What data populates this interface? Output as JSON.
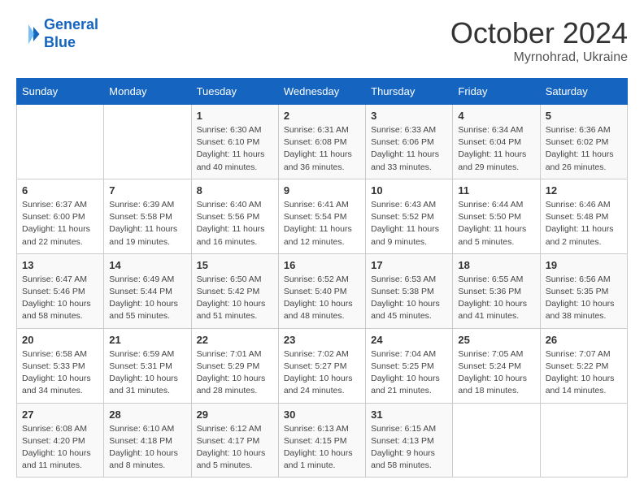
{
  "header": {
    "logo_line1": "General",
    "logo_line2": "Blue",
    "month": "October 2024",
    "location": "Myrnohrad, Ukraine"
  },
  "days_of_week": [
    "Sunday",
    "Monday",
    "Tuesday",
    "Wednesday",
    "Thursday",
    "Friday",
    "Saturday"
  ],
  "weeks": [
    [
      {
        "day": "",
        "detail": ""
      },
      {
        "day": "",
        "detail": ""
      },
      {
        "day": "1",
        "detail": "Sunrise: 6:30 AM\nSunset: 6:10 PM\nDaylight: 11 hours and 40 minutes."
      },
      {
        "day": "2",
        "detail": "Sunrise: 6:31 AM\nSunset: 6:08 PM\nDaylight: 11 hours and 36 minutes."
      },
      {
        "day": "3",
        "detail": "Sunrise: 6:33 AM\nSunset: 6:06 PM\nDaylight: 11 hours and 33 minutes."
      },
      {
        "day": "4",
        "detail": "Sunrise: 6:34 AM\nSunset: 6:04 PM\nDaylight: 11 hours and 29 minutes."
      },
      {
        "day": "5",
        "detail": "Sunrise: 6:36 AM\nSunset: 6:02 PM\nDaylight: 11 hours and 26 minutes."
      }
    ],
    [
      {
        "day": "6",
        "detail": "Sunrise: 6:37 AM\nSunset: 6:00 PM\nDaylight: 11 hours and 22 minutes."
      },
      {
        "day": "7",
        "detail": "Sunrise: 6:39 AM\nSunset: 5:58 PM\nDaylight: 11 hours and 19 minutes."
      },
      {
        "day": "8",
        "detail": "Sunrise: 6:40 AM\nSunset: 5:56 PM\nDaylight: 11 hours and 16 minutes."
      },
      {
        "day": "9",
        "detail": "Sunrise: 6:41 AM\nSunset: 5:54 PM\nDaylight: 11 hours and 12 minutes."
      },
      {
        "day": "10",
        "detail": "Sunrise: 6:43 AM\nSunset: 5:52 PM\nDaylight: 11 hours and 9 minutes."
      },
      {
        "day": "11",
        "detail": "Sunrise: 6:44 AM\nSunset: 5:50 PM\nDaylight: 11 hours and 5 minutes."
      },
      {
        "day": "12",
        "detail": "Sunrise: 6:46 AM\nSunset: 5:48 PM\nDaylight: 11 hours and 2 minutes."
      }
    ],
    [
      {
        "day": "13",
        "detail": "Sunrise: 6:47 AM\nSunset: 5:46 PM\nDaylight: 10 hours and 58 minutes."
      },
      {
        "day": "14",
        "detail": "Sunrise: 6:49 AM\nSunset: 5:44 PM\nDaylight: 10 hours and 55 minutes."
      },
      {
        "day": "15",
        "detail": "Sunrise: 6:50 AM\nSunset: 5:42 PM\nDaylight: 10 hours and 51 minutes."
      },
      {
        "day": "16",
        "detail": "Sunrise: 6:52 AM\nSunset: 5:40 PM\nDaylight: 10 hours and 48 minutes."
      },
      {
        "day": "17",
        "detail": "Sunrise: 6:53 AM\nSunset: 5:38 PM\nDaylight: 10 hours and 45 minutes."
      },
      {
        "day": "18",
        "detail": "Sunrise: 6:55 AM\nSunset: 5:36 PM\nDaylight: 10 hours and 41 minutes."
      },
      {
        "day": "19",
        "detail": "Sunrise: 6:56 AM\nSunset: 5:35 PM\nDaylight: 10 hours and 38 minutes."
      }
    ],
    [
      {
        "day": "20",
        "detail": "Sunrise: 6:58 AM\nSunset: 5:33 PM\nDaylight: 10 hours and 34 minutes."
      },
      {
        "day": "21",
        "detail": "Sunrise: 6:59 AM\nSunset: 5:31 PM\nDaylight: 10 hours and 31 minutes."
      },
      {
        "day": "22",
        "detail": "Sunrise: 7:01 AM\nSunset: 5:29 PM\nDaylight: 10 hours and 28 minutes."
      },
      {
        "day": "23",
        "detail": "Sunrise: 7:02 AM\nSunset: 5:27 PM\nDaylight: 10 hours and 24 minutes."
      },
      {
        "day": "24",
        "detail": "Sunrise: 7:04 AM\nSunset: 5:25 PM\nDaylight: 10 hours and 21 minutes."
      },
      {
        "day": "25",
        "detail": "Sunrise: 7:05 AM\nSunset: 5:24 PM\nDaylight: 10 hours and 18 minutes."
      },
      {
        "day": "26",
        "detail": "Sunrise: 7:07 AM\nSunset: 5:22 PM\nDaylight: 10 hours and 14 minutes."
      }
    ],
    [
      {
        "day": "27",
        "detail": "Sunrise: 6:08 AM\nSunset: 4:20 PM\nDaylight: 10 hours and 11 minutes."
      },
      {
        "day": "28",
        "detail": "Sunrise: 6:10 AM\nSunset: 4:18 PM\nDaylight: 10 hours and 8 minutes."
      },
      {
        "day": "29",
        "detail": "Sunrise: 6:12 AM\nSunset: 4:17 PM\nDaylight: 10 hours and 5 minutes."
      },
      {
        "day": "30",
        "detail": "Sunrise: 6:13 AM\nSunset: 4:15 PM\nDaylight: 10 hours and 1 minute."
      },
      {
        "day": "31",
        "detail": "Sunrise: 6:15 AM\nSunset: 4:13 PM\nDaylight: 9 hours and 58 minutes."
      },
      {
        "day": "",
        "detail": ""
      },
      {
        "day": "",
        "detail": ""
      }
    ]
  ]
}
